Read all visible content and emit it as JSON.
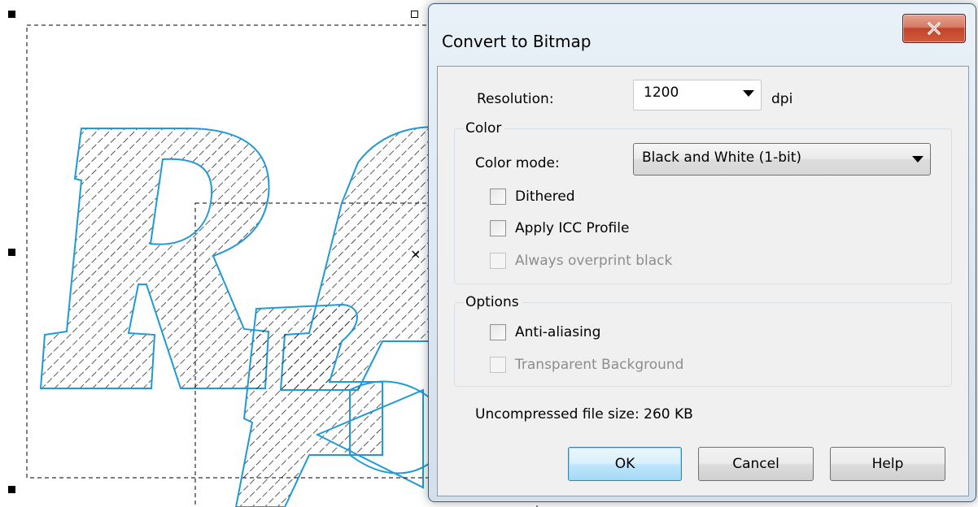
{
  "dialog": {
    "title": "Convert to Bitmap",
    "close_icon": "close-x-icon",
    "resolution": {
      "label": "Resolution:",
      "value": "1200",
      "unit": "dpi"
    },
    "color_group": {
      "title": "Color",
      "color_mode_label": "Color mode:",
      "color_mode_value": "Black and White (1-bit)",
      "dithered": {
        "label": "Dithered",
        "checked": false,
        "enabled": true
      },
      "apply_icc": {
        "label": "Apply ICC Profile",
        "checked": false,
        "enabled": true
      },
      "overprint": {
        "label": "Always overprint black",
        "checked": false,
        "enabled": false
      }
    },
    "options_group": {
      "title": "Options",
      "anti_aliasing": {
        "label": "Anti-aliasing",
        "checked": false,
        "enabled": true
      },
      "transparent_bg": {
        "label": "Transparent Background",
        "checked": false,
        "enabled": false
      }
    },
    "file_size_text": "Uncompressed file size: 260 KB",
    "buttons": {
      "ok": "OK",
      "cancel": "Cancel",
      "help": "Help"
    }
  },
  "canvas": {
    "outline_color": "#1f9ad6",
    "hatch_color": "#000000",
    "selection_handle_color": "#000000"
  }
}
